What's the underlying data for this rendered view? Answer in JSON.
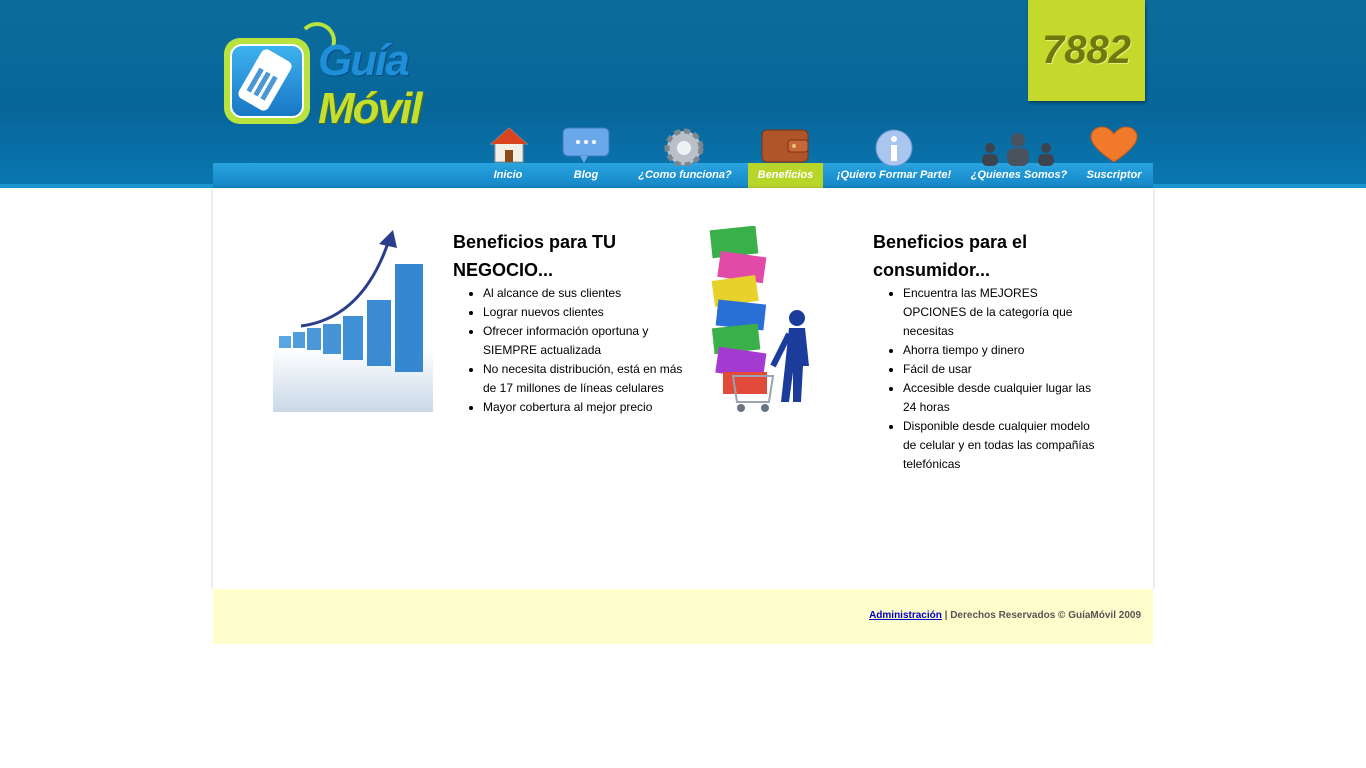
{
  "brand": {
    "line1": "Guía",
    "line2": "Móvil",
    "code": "7882"
  },
  "nav": [
    {
      "label": "Inicio",
      "icon": "home-icon"
    },
    {
      "label": "Blog",
      "icon": "chat-bubble-icon"
    },
    {
      "label": "¿Como funciona?",
      "icon": "gear-icon"
    },
    {
      "label": "Beneficios",
      "icon": "wallet-icon",
      "active": true
    },
    {
      "label": "¡Quiero Formar Parte!",
      "icon": "info-icon"
    },
    {
      "label": "¿Quienes Somos?",
      "icon": "people-icon"
    },
    {
      "label": "Suscriptor",
      "icon": "heart-icon"
    }
  ],
  "business": {
    "title": "Beneficios para TU NEGOCIO...",
    "items": [
      "Al alcance de sus clientes",
      "Lograr nuevos clientes",
      "Ofrecer información oportuna y SIEMPRE actualizada",
      "No necesita distribución, está en más de 17 millones de líneas celulares",
      "Mayor cobertura al mejor precio"
    ]
  },
  "consumer": {
    "title": "Beneficios para el consumidor...",
    "items": [
      "Encuentra las MEJORES OPCIONES de la categoría que necesitas",
      "Ahorra tiempo y dinero",
      "Fácil de usar",
      "Accesible desde cualquier lugar las 24 horas",
      "Disponible desde cualquier modelo de celular y en todas las compañías telefónicas"
    ]
  },
  "footer": {
    "admin_link": "Administración",
    "rights": " | Derechos Reservados © GuíaMóvil 2009"
  },
  "colors": {
    "header": "#08669a",
    "accent": "#b8d62a",
    "footer_bg": "#fefdcc"
  }
}
